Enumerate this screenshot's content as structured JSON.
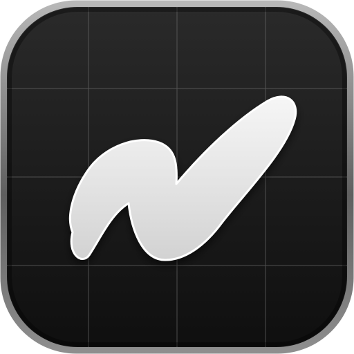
{
  "icon": {
    "name": "app-icon",
    "glyph": "stylized-letter-n-icon",
    "colors": {
      "background_top": "#2a2a2a",
      "background_bottom": "#0f0f0f",
      "border": "#8a8a8a",
      "grid": "#6e6e6e",
      "glyph_fill": "#e6e6e6",
      "glyph_stroke": "#ffffff"
    }
  }
}
